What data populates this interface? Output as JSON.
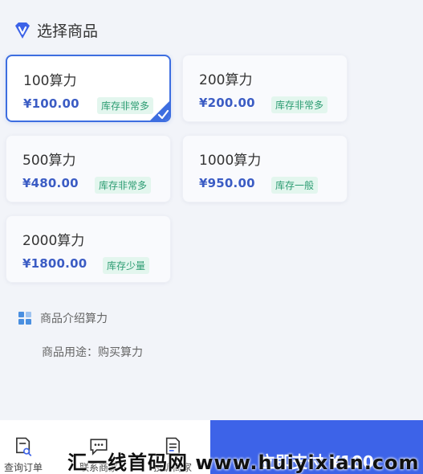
{
  "header": {
    "title": "选择商品"
  },
  "products": [
    {
      "name": "100算力",
      "price": "¥100.00",
      "stock": "库存非常多",
      "selected": true
    },
    {
      "name": "200算力",
      "price": "¥200.00",
      "stock": "库存非常多",
      "selected": false
    },
    {
      "name": "500算力",
      "price": "¥480.00",
      "stock": "库存非常多",
      "selected": false
    },
    {
      "name": "1000算力",
      "price": "¥950.00",
      "stock": "库存一般",
      "selected": false
    },
    {
      "name": "2000算力",
      "price": "¥1800.00",
      "stock": "库存少量",
      "selected": false
    }
  ],
  "intro": {
    "title": "商品介绍算力",
    "usage": "商品用途：购买算力"
  },
  "bottom_bar": {
    "query_order": "查询订单",
    "contact_merchant": "联系商家",
    "complain_merchant": "投诉商家",
    "pay_label": "立即支付 ¥100"
  },
  "watermark": "汇一线首码网 www.huiyixian.com",
  "colors": {
    "accent": "#3d63e8",
    "price": "#3b5cc4",
    "stock_text": "#2c9c72",
    "stock_bg": "#e3f6ee"
  }
}
